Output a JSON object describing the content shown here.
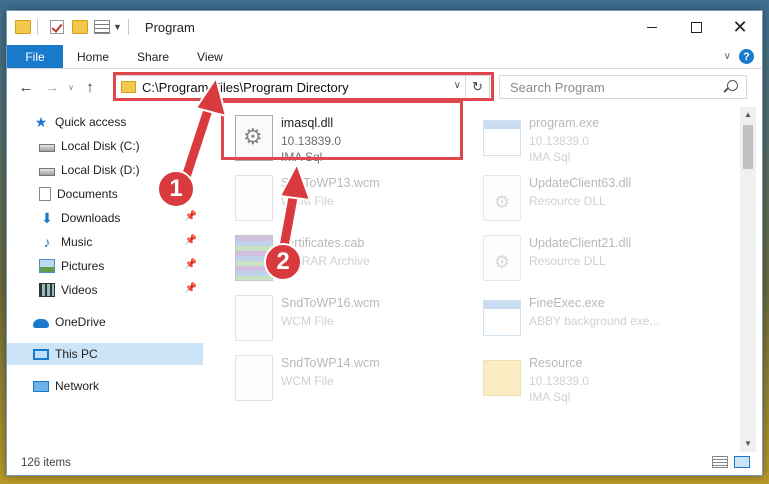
{
  "window": {
    "title": "Program",
    "controls": {
      "minimize": "",
      "maximize": "",
      "close": "✕"
    }
  },
  "ribbon": {
    "file": "File",
    "tabs": [
      "Home",
      "Share",
      "View"
    ],
    "help": "?"
  },
  "nav": {
    "back": "←",
    "forward": "→",
    "up": "↑",
    "address": "C:\\Program Files\\Program Directory",
    "search_placeholder": "Search Program"
  },
  "sidebar": {
    "items": [
      {
        "label": "Quick access",
        "icon": "star-icon"
      },
      {
        "label": "Local Disk (C:)",
        "icon": "disk-icon"
      },
      {
        "label": "Local Disk (D:)",
        "icon": "disk-icon"
      },
      {
        "label": "Documents",
        "icon": "documents-icon"
      },
      {
        "label": "Downloads",
        "icon": "download-icon"
      },
      {
        "label": "Music",
        "icon": "music-icon"
      },
      {
        "label": "Pictures",
        "icon": "pictures-icon"
      },
      {
        "label": "Videos",
        "icon": "videos-icon"
      },
      {
        "label": "OneDrive",
        "icon": "onedrive-icon"
      },
      {
        "label": "This PC",
        "icon": "computer-icon"
      },
      {
        "label": "Network",
        "icon": "network-icon"
      }
    ]
  },
  "files": [
    {
      "name": "imasql.dll",
      "line2": "10.13839.0",
      "line3": "IMA Sql"
    },
    {
      "name": "program.exe",
      "line2": "10.13839.0",
      "line3": "IMA Sql"
    },
    {
      "name": "SndToWP13.wcm",
      "line2": "WCM File",
      "line3": ""
    },
    {
      "name": "UpdateClient63.dll",
      "line2": "Resource DLL",
      "line3": ""
    },
    {
      "name": "certificates.cab",
      "line2": "WinRAR Archive",
      "line3": ""
    },
    {
      "name": "UpdateClient21.dll",
      "line2": "Resource DLL",
      "line3": ""
    },
    {
      "name": "SndToWP16.wcm",
      "line2": "WCM File",
      "line3": ""
    },
    {
      "name": "FineExec.exe",
      "line2": "ABBY background exe...",
      "line3": ""
    },
    {
      "name": "SndToWP14.wcm",
      "line2": "WCM File",
      "line3": ""
    },
    {
      "name": "Resource",
      "line2": "10.13839.0",
      "line3": "IMA Sql"
    }
  ],
  "status": {
    "count": "126 items"
  },
  "annotations": {
    "step1": "1",
    "step2": "2",
    "color": "#d93a3e"
  }
}
